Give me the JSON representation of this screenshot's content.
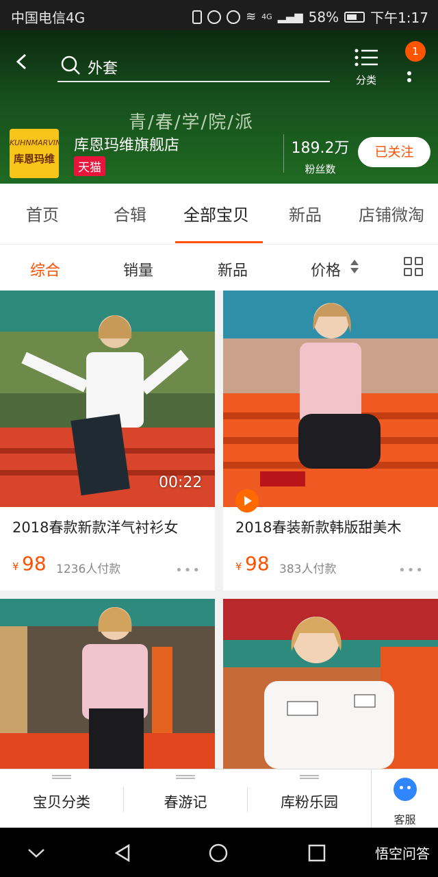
{
  "status_bar": {
    "carrier": "中国电信4G",
    "signal": "4G",
    "battery": "58%",
    "time": "下午1:17"
  },
  "header": {
    "search_query": "外套",
    "category_label": "分类",
    "notification_badge": "1",
    "slogan": "青/春/学/院/派",
    "shop_logo_en": "KUHNMARVIN",
    "shop_logo_cn": "库恩玛维",
    "shop_name": "库恩玛维旗舰店",
    "platform_badge": "天猫",
    "fans_count": "189.2万",
    "fans_label": "粉丝数",
    "follow_label": "已关注"
  },
  "tabs": [
    "首页",
    "合辑",
    "全部宝贝",
    "新品",
    "店铺微淘"
  ],
  "active_tab": "全部宝贝",
  "sort_options": [
    "综合",
    "销量",
    "新品",
    "价格"
  ],
  "products": [
    {
      "title": "2018春款新款洋气衬衫女",
      "currency": "¥",
      "price": "98",
      "sold": "1236人付款",
      "video_duration": "00:22"
    },
    {
      "title": "2018春装新款韩版甜美木",
      "currency": "¥",
      "price": "98",
      "sold": "383人付款"
    },
    {
      "title": "",
      "price": "",
      "sold": ""
    },
    {
      "title": "",
      "price": "",
      "sold": ""
    }
  ],
  "shop_nav": [
    "宝贝分类",
    "春游记",
    "库粉乐园"
  ],
  "service_label": "客服",
  "watermark": "悟空问答",
  "colors": {
    "accent": "#ff5000",
    "header_bg": "#174f1c",
    "tmall_red": "#e8143c",
    "service_blue": "#2f86ff"
  }
}
